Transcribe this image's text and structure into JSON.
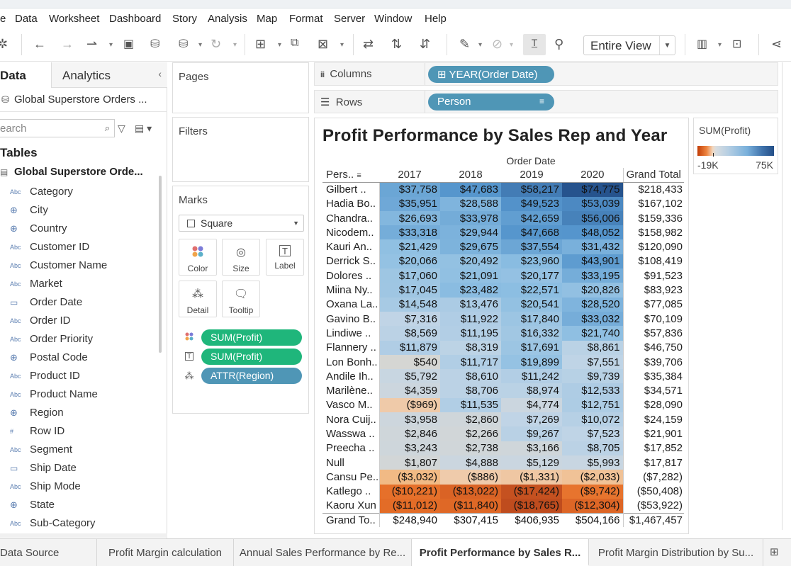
{
  "menu": [
    "e",
    "Data",
    "Worksheet",
    "Dashboard",
    "Story",
    "Analysis",
    "Map",
    "Format",
    "Server",
    "Window",
    "Help"
  ],
  "toolbar": {
    "view_mode": "Entire View"
  },
  "left": {
    "tab_data": "Data",
    "tab_analytics": "Analytics",
    "datasource": "Global Superstore Orders ...",
    "search_placeholder": "earch",
    "tables_heading": "Tables",
    "table_name": "Global Superstore Orde...",
    "fields": [
      {
        "type": "Abc",
        "name": "Category"
      },
      {
        "type": "geo",
        "name": "City"
      },
      {
        "type": "geo",
        "name": "Country"
      },
      {
        "type": "Abc",
        "name": "Customer ID"
      },
      {
        "type": "Abc",
        "name": "Customer Name"
      },
      {
        "type": "Abc",
        "name": "Market"
      },
      {
        "type": "date",
        "name": "Order Date"
      },
      {
        "type": "Abc",
        "name": "Order ID"
      },
      {
        "type": "Abc",
        "name": "Order Priority"
      },
      {
        "type": "geo",
        "name": "Postal Code"
      },
      {
        "type": "Abc",
        "name": "Product ID"
      },
      {
        "type": "Abc",
        "name": "Product Name"
      },
      {
        "type": "geo",
        "name": "Region"
      },
      {
        "type": "num",
        "name": "Row ID"
      },
      {
        "type": "Abc",
        "name": "Segment"
      },
      {
        "type": "date",
        "name": "Ship Date"
      },
      {
        "type": "Abc",
        "name": "Ship Mode"
      },
      {
        "type": "geo",
        "name": "State"
      },
      {
        "type": "Abc",
        "name": "Sub-Category"
      }
    ]
  },
  "cards": {
    "pages": "Pages",
    "filters": "Filters",
    "marks": "Marks",
    "mark_type": "Square",
    "buttons": [
      "Color",
      "Size",
      "Label",
      "Detail",
      "Tooltip"
    ],
    "pills": [
      {
        "icon": "color",
        "label": "SUM(Profit)",
        "kind": "green"
      },
      {
        "icon": "label",
        "label": "SUM(Profit)",
        "kind": "green"
      },
      {
        "icon": "detail",
        "label": "ATTR(Region)",
        "kind": "blue"
      }
    ]
  },
  "shelves": {
    "columns_label": "Columns",
    "columns_pill": "YEAR(Order Date)",
    "rows_label": "Rows",
    "rows_pill": "Person"
  },
  "viz": {
    "title": "Profit Performance by Sales Rep and Year",
    "column_header": "Order Date",
    "row_header": "Pers..",
    "years": [
      "2017",
      "2018",
      "2019",
      "2020"
    ],
    "grand_total_label": "Grand Total",
    "total_row_label": "Grand To..",
    "rows": [
      {
        "p": "Gilbert ..",
        "v": [
          37758,
          47683,
          58217,
          74775
        ],
        "c": [
          "$37,758",
          "$47,683",
          "$58,217",
          "$74,775"
        ],
        "t": "$218,433"
      },
      {
        "p": "Hadia Bo..",
        "v": [
          35951,
          28588,
          49523,
          53039
        ],
        "c": [
          "$35,951",
          "$28,588",
          "$49,523",
          "$53,039"
        ],
        "t": "$167,102"
      },
      {
        "p": "Chandra..",
        "v": [
          26693,
          33978,
          42659,
          56006
        ],
        "c": [
          "$26,693",
          "$33,978",
          "$42,659",
          "$56,006"
        ],
        "t": "$159,336"
      },
      {
        "p": "Nicodem..",
        "v": [
          33318,
          29944,
          47668,
          48052
        ],
        "c": [
          "$33,318",
          "$29,944",
          "$47,668",
          "$48,052"
        ],
        "t": "$158,982"
      },
      {
        "p": "Kauri An..",
        "v": [
          21429,
          29675,
          37554,
          31432
        ],
        "c": [
          "$21,429",
          "$29,675",
          "$37,554",
          "$31,432"
        ],
        "t": "$120,090"
      },
      {
        "p": "Derrick S..",
        "v": [
          20066,
          20492,
          23960,
          43901
        ],
        "c": [
          "$20,066",
          "$20,492",
          "$23,960",
          "$43,901"
        ],
        "t": "$108,419"
      },
      {
        "p": "Dolores ..",
        "v": [
          17060,
          21091,
          20177,
          33195
        ],
        "c": [
          "$17,060",
          "$21,091",
          "$20,177",
          "$33,195"
        ],
        "t": "$91,523"
      },
      {
        "p": "Miina Ny..",
        "v": [
          17045,
          23482,
          22571,
          20826
        ],
        "c": [
          "$17,045",
          "$23,482",
          "$22,571",
          "$20,826"
        ],
        "t": "$83,923"
      },
      {
        "p": "Oxana La..",
        "v": [
          14548,
          13476,
          20541,
          28520
        ],
        "c": [
          "$14,548",
          "$13,476",
          "$20,541",
          "$28,520"
        ],
        "t": "$77,085"
      },
      {
        "p": "Gavino B..",
        "v": [
          7316,
          11922,
          17840,
          33032
        ],
        "c": [
          "$7,316",
          "$11,922",
          "$17,840",
          "$33,032"
        ],
        "t": "$70,109"
      },
      {
        "p": "Lindiwe ..",
        "v": [
          8569,
          11195,
          16332,
          21740
        ],
        "c": [
          "$8,569",
          "$11,195",
          "$16,332",
          "$21,740"
        ],
        "t": "$57,836"
      },
      {
        "p": "Flannery ..",
        "v": [
          11879,
          8319,
          17691,
          8861
        ],
        "c": [
          "$11,879",
          "$8,319",
          "$17,691",
          "$8,861"
        ],
        "t": "$46,750"
      },
      {
        "p": "Lon Bonh..",
        "v": [
          540,
          11717,
          19899,
          7551
        ],
        "c": [
          "$540",
          "$11,717",
          "$19,899",
          "$7,551"
        ],
        "t": "$39,706"
      },
      {
        "p": "Andile Ih..",
        "v": [
          5792,
          8610,
          11242,
          9739
        ],
        "c": [
          "$5,792",
          "$8,610",
          "$11,242",
          "$9,739"
        ],
        "t": "$35,384"
      },
      {
        "p": "Marilène..",
        "v": [
          4359,
          8706,
          8974,
          12533
        ],
        "c": [
          "$4,359",
          "$8,706",
          "$8,974",
          "$12,533"
        ],
        "t": "$34,571"
      },
      {
        "p": "Vasco M..",
        "v": [
          -969,
          11535,
          4774,
          12751
        ],
        "c": [
          "($969)",
          "$11,535",
          "$4,774",
          "$12,751"
        ],
        "t": "$28,090"
      },
      {
        "p": "Nora Cuij..",
        "v": [
          3958,
          2860,
          7269,
          10072
        ],
        "c": [
          "$3,958",
          "$2,860",
          "$7,269",
          "$10,072"
        ],
        "t": "$24,159"
      },
      {
        "p": "Wasswa ..",
        "v": [
          2846,
          2266,
          9267,
          7523
        ],
        "c": [
          "$2,846",
          "$2,266",
          "$9,267",
          "$7,523"
        ],
        "t": "$21,901"
      },
      {
        "p": "Preecha ..",
        "v": [
          3243,
          2738,
          3166,
          8705
        ],
        "c": [
          "$3,243",
          "$2,738",
          "$3,166",
          "$8,705"
        ],
        "t": "$17,852"
      },
      {
        "p": "Null",
        "v": [
          1807,
          4888,
          5129,
          5993
        ],
        "c": [
          "$1,807",
          "$4,888",
          "$5,129",
          "$5,993"
        ],
        "t": "$17,817"
      },
      {
        "p": "Cansu Pe..",
        "v": [
          -3032,
          -886,
          -1331,
          -2033
        ],
        "c": [
          "($3,032)",
          "($886)",
          "($1,331)",
          "($2,033)"
        ],
        "t": "($7,282)"
      },
      {
        "p": "Katlego ..",
        "v": [
          -10221,
          -13022,
          -17424,
          -9742
        ],
        "c": [
          "($10,221)",
          "($13,022)",
          "($17,424)",
          "($9,742)"
        ],
        "t": "($50,408)"
      },
      {
        "p": "Kaoru Xun",
        "v": [
          -11012,
          -11840,
          -18765,
          -12304
        ],
        "c": [
          "($11,012)",
          "($11,840)",
          "($18,765)",
          "($12,304)"
        ],
        "t": "($53,922)"
      }
    ],
    "totals": [
      "$248,940",
      "$307,415",
      "$406,935",
      "$504,166"
    ],
    "grand_total": "$1,467,457"
  },
  "legend": {
    "title": "SUM(Profit)",
    "min": -19,
    "max": 75,
    "min_label": "-19K",
    "max_label": "75K"
  },
  "sheet_tabs": [
    "Data Source",
    "Profit Margin calculation",
    "Annual Sales Performance by Re...",
    "Profit Performance by Sales R...",
    "Profit Margin Distribution by Su..."
  ],
  "active_sheet": 3,
  "chart_data": {
    "type": "heatmap",
    "title": "Profit Performance by Sales Rep and Year",
    "xlabel": "Order Date",
    "categories": [
      "2017",
      "2018",
      "2019",
      "2020"
    ],
    "color_range": [
      -19000,
      75000
    ]
  }
}
